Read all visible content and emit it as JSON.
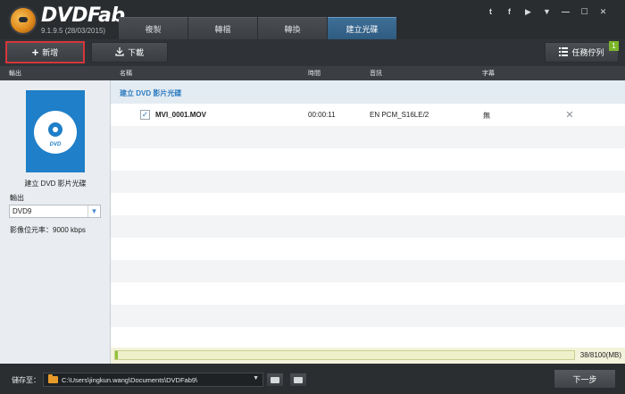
{
  "app": {
    "brand": "DVDFab",
    "version": "9.1.9.5 (28/03/2015)"
  },
  "tabs": [
    {
      "label": "複製"
    },
    {
      "label": "轉檔"
    },
    {
      "label": "轉換"
    },
    {
      "label": "建立光碟"
    }
  ],
  "window_controls": [
    {
      "icon": "twitter-icon",
      "glyph": "t"
    },
    {
      "icon": "facebook-icon",
      "glyph": "f"
    },
    {
      "icon": "youtube-icon",
      "glyph": "▶"
    },
    {
      "icon": "menu-arrow-icon",
      "glyph": "▼"
    },
    {
      "icon": "minimize-icon",
      "glyph": "—"
    },
    {
      "icon": "maximize-icon",
      "glyph": "☐"
    },
    {
      "icon": "close-icon",
      "glyph": "✕"
    }
  ],
  "toolbar": {
    "add_label": "新增",
    "download_label": "下載",
    "queue_label": "任務佇列",
    "queue_count": "1"
  },
  "columns": {
    "output": "輸出",
    "name": "名稱",
    "time": "時間",
    "audio": "音訊",
    "subtitle": "字幕"
  },
  "left_panel": {
    "disc_label": "DVD",
    "title": "建立 DVD 影片光碟",
    "output_label": "輸出",
    "output_value": "DVD9",
    "bitrate": "影像位元率：9000 kbps"
  },
  "list": {
    "group_title": "建立 DVD 影片光碟",
    "items": [
      {
        "name": "MVI_0001.MOV",
        "time": "00:00:11",
        "audio": "EN  PCM_S16LE/2",
        "subtitle": "無"
      }
    ]
  },
  "progress": {
    "text": "38/8100(MB)",
    "fraction": 0.0047
  },
  "footer": {
    "save_label": "儲存至：",
    "path": "C:\\Users\\jingkun.wang\\Documents\\DVDFab9\\",
    "next_label": "下一步"
  },
  "colors": {
    "accent_blue": "#1f7fc8",
    "add_button_border": "#d6353a",
    "queue_badge": "#7bb52a",
    "progress_fill": "#8fc33a"
  }
}
